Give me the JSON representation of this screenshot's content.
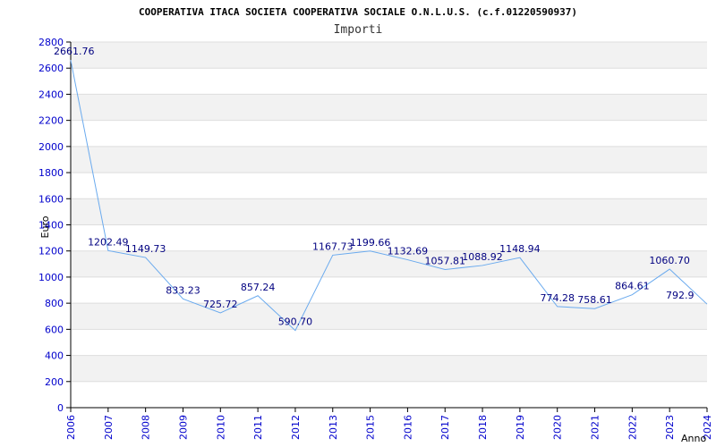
{
  "chart_data": {
    "type": "line",
    "title": "COOPERATIVA ITACA SOCIETA COOPERATIVA SOCIALE O.N.L.U.S. (c.f.01220590937)",
    "subtitle": "Importi",
    "xlabel": "Anno",
    "ylabel": "Euro",
    "ylim": [
      0,
      2800
    ],
    "yticks": [
      "0",
      "200",
      "400",
      "600",
      "800",
      "1000",
      "1200",
      "1400",
      "1600",
      "1800",
      "2000",
      "2200",
      "2400",
      "2600",
      "2800"
    ],
    "grid": true,
    "categories": [
      "2006",
      "2007",
      "2008",
      "2009",
      "2010",
      "2011",
      "2012",
      "2013",
      "2015",
      "2016",
      "2017",
      "2018",
      "2019",
      "2020",
      "2021",
      "2022",
      "2023",
      "2024"
    ],
    "values": [
      2661.76,
      1202.49,
      1149.73,
      833.23,
      725.72,
      857.24,
      590.7,
      1167.73,
      1199.66,
      1132.69,
      1057.81,
      1088.92,
      1148.94,
      774.28,
      758.61,
      864.61,
      1060.7,
      792.9
    ],
    "data_labels": [
      "2661.76",
      "1202.49",
      "1149.73",
      "833.23",
      "725.72",
      "857.24",
      "590.70",
      "1167.73",
      "1199.66",
      "1132.69",
      "1057.81",
      "1088.92",
      "1148.94",
      "774.28",
      "758.61",
      "864.61",
      "1060.70",
      "792.9"
    ],
    "colors": {
      "line": "#6aaaee",
      "band": "#f2f2f2",
      "grid": "#dddddd",
      "axis": "#000000",
      "tick_text": "#0000cc",
      "point_label": "#000080"
    }
  }
}
